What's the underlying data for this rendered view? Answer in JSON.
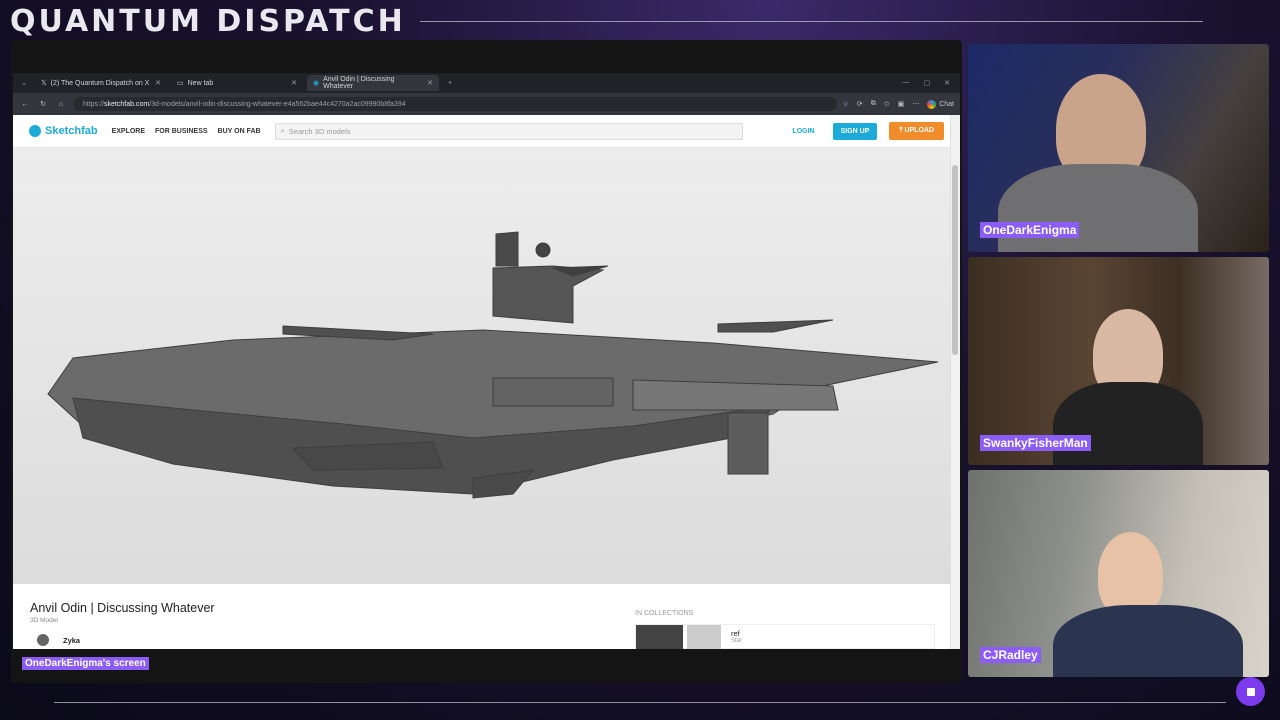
{
  "brand": {
    "title": "QUANTUM DISPATCH"
  },
  "browser": {
    "tabs": [
      {
        "label": "(2) The Quantum Dispatch on X",
        "active": false
      },
      {
        "label": "New tab",
        "active": false
      },
      {
        "label": "Anvil Odin | Discussing Whatever",
        "active": true
      }
    ],
    "url_prefix": "https://",
    "url_domain": "sketchfab.com",
    "url_path": "/3d-models/anvil-odin-discussing-whatever-e4a562bae44c4270a2ac09990b8fa394",
    "chat_label": "Chat"
  },
  "sketchfab": {
    "logo": "Sketchfab",
    "nav": [
      "EXPLORE",
      "FOR BUSINESS",
      "BUY ON FAB"
    ],
    "search_placeholder": "Search 3D models",
    "login": "LOGIN",
    "signup": "SIGN UP",
    "upload": "UPLOAD",
    "model_title": "Anvil Odin | Discussing Whatever",
    "model_type": "3D Model",
    "author": "Zyka",
    "collections_heading": "IN COLLECTIONS",
    "collection_name": "ref",
    "collection_sub": "Star"
  },
  "screen_label": "OneDarkEnigma's screen",
  "cams": [
    {
      "name": "OneDarkEnigma"
    },
    {
      "name": "SwankyFisherMan"
    },
    {
      "name": "CJRadley"
    }
  ],
  "colors": {
    "accent": "#8b5cf6",
    "sketchfab_blue": "#1caad9",
    "upload_orange": "#f08c2a"
  }
}
